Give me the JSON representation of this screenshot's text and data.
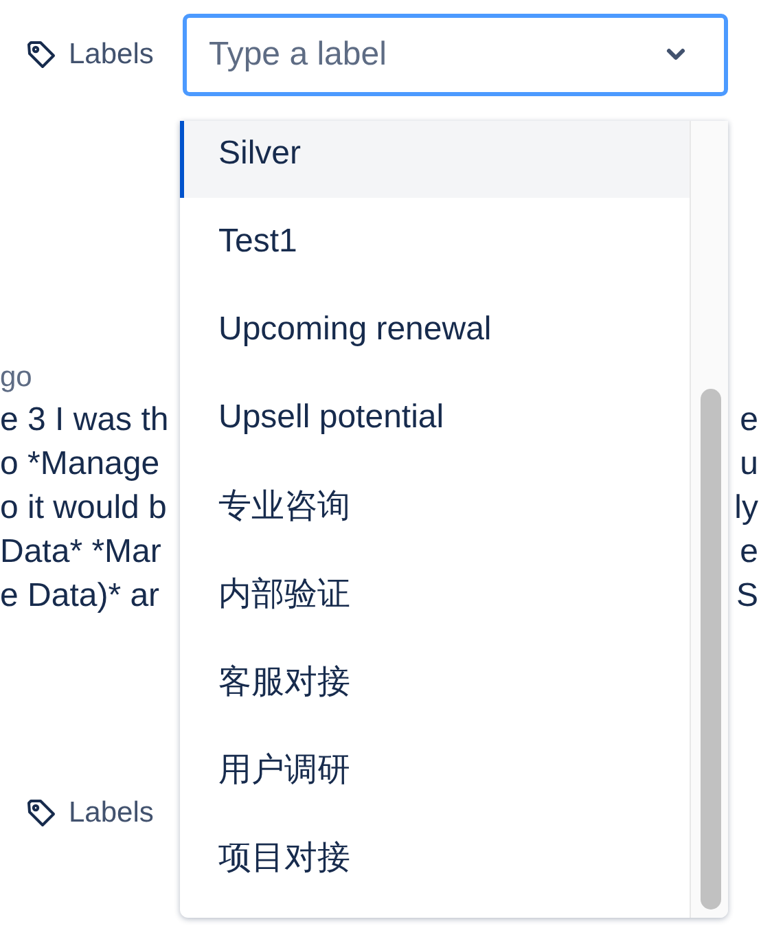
{
  "labels_field": {
    "label": "Labels",
    "placeholder": "Type a label"
  },
  "comment": {
    "time": "go",
    "lines": [
      {
        "left": "e 3 I was th",
        "right": "e"
      },
      {
        "left": "o *Manage",
        "right": "u"
      },
      {
        "left": "o it would b",
        "right": "ly"
      },
      {
        "left": "Data* *Mar",
        "right": "e"
      },
      {
        "left": "e Data)* ar",
        "right": "S"
      }
    ]
  },
  "labels_2": {
    "label": "Labels"
  },
  "dropdown": {
    "options": [
      {
        "label": "Silver",
        "selected": true
      },
      {
        "label": "Test1",
        "selected": false
      },
      {
        "label": "Upcoming renewal",
        "selected": false
      },
      {
        "label": "Upsell potential",
        "selected": false
      },
      {
        "label": "专业咨询",
        "selected": false
      },
      {
        "label": "内部验证",
        "selected": false
      },
      {
        "label": "客服对接",
        "selected": false
      },
      {
        "label": "用户调研",
        "selected": false
      },
      {
        "label": "项目对接",
        "selected": false
      }
    ]
  }
}
